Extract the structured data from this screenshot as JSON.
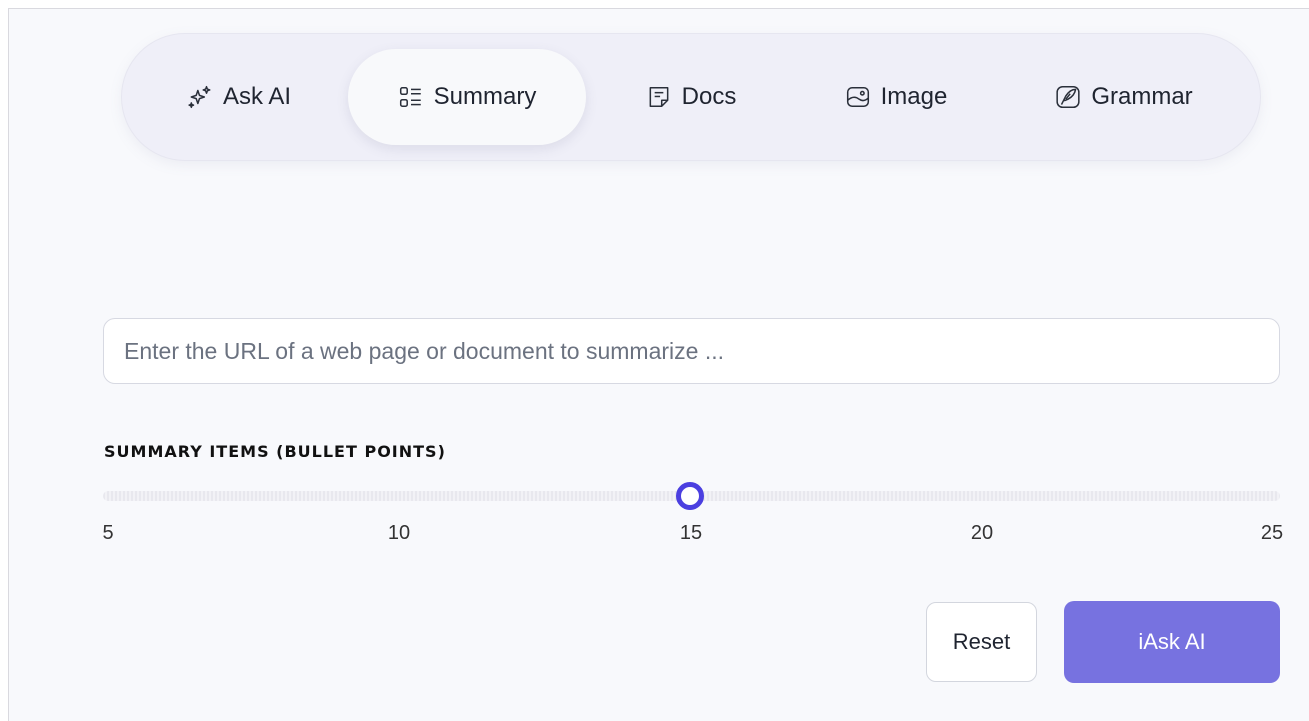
{
  "tabs": [
    {
      "label": "Ask AI",
      "icon": "sparkles-icon"
    },
    {
      "label": "Summary",
      "icon": "list-icon",
      "active": true
    },
    {
      "label": "Docs",
      "icon": "document-icon"
    },
    {
      "label": "Image",
      "icon": "image-icon"
    },
    {
      "label": "Grammar",
      "icon": "feather-pen-icon"
    }
  ],
  "url_input": {
    "placeholder": "Enter the URL of a web page or document to summarize ...",
    "value": ""
  },
  "slider": {
    "label": "SUMMARY ITEMS (BULLET POINTS)",
    "min": 5,
    "max": 25,
    "value": 15,
    "ticks": [
      "5",
      "10",
      "15",
      "20",
      "25"
    ],
    "accent_color": "#4b3fe0"
  },
  "buttons": {
    "reset_label": "Reset",
    "submit_label": "iAsk AI"
  },
  "colors": {
    "primary_button": "#7772e0",
    "tab_bar": "#efeff8"
  }
}
